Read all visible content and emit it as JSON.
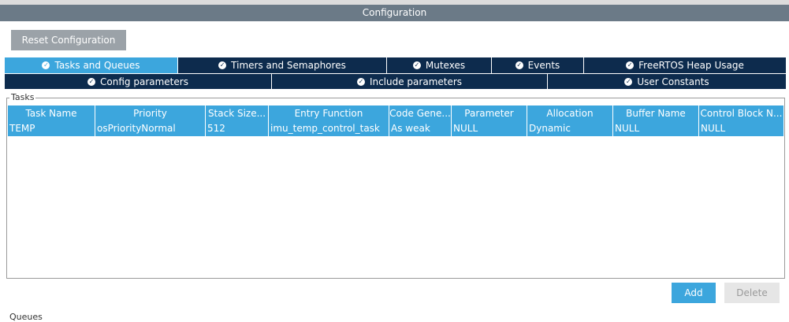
{
  "window": {
    "title": "Configuration"
  },
  "toolbar": {
    "reset_label": "Reset Configuration"
  },
  "tabs_row1": [
    {
      "label": "Tasks and Queues",
      "active": true
    },
    {
      "label": "Timers and Semaphores",
      "active": false
    },
    {
      "label": "Mutexes",
      "active": false
    },
    {
      "label": "Events",
      "active": false
    },
    {
      "label": "FreeRTOS Heap Usage",
      "active": false
    }
  ],
  "tabs_row2": [
    {
      "label": "Config parameters"
    },
    {
      "label": "Include parameters"
    },
    {
      "label": "User Constants"
    }
  ],
  "tasks": {
    "group_label": "Tasks",
    "columns": [
      "Task Name",
      "Priority",
      "Stack Size...",
      "Entry Function",
      "Code Gene...",
      "Parameter",
      "Allocation",
      "Buffer Name",
      "Control Block N..."
    ],
    "rows": [
      [
        "TEMP",
        "osPriorityNormal",
        "512",
        "imu_temp_control_task",
        "As weak",
        "NULL",
        "Dynamic",
        "NULL",
        "NULL"
      ]
    ],
    "add_label": "Add",
    "delete_label": "Delete"
  },
  "queues": {
    "group_label": "Queues"
  },
  "colors": {
    "accent": "#3ca6dd",
    "navy": "#0d2b4d",
    "titlebar": "#6b7a87"
  }
}
